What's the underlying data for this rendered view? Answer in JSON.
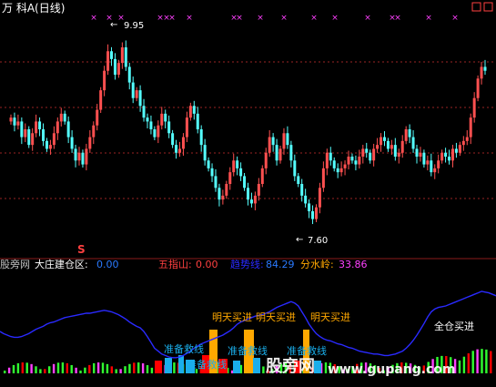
{
  "title": "万 科A(日线)",
  "colors": {
    "up": "#ff5050",
    "down": "#54ffff",
    "grid": "#9a2424",
    "cross": "#ff40ff",
    "orange": "#ffa800",
    "blue": "#2a2aff",
    "cyan": "#1aaeea",
    "red": "#ff0000",
    "green": "#30ff30",
    "magenta": "#ff40ff"
  },
  "chart_data": [
    {
      "type": "candlestick",
      "title": "万 科A(日线)",
      "annotations": {
        "high": "9.95",
        "low": "7.60",
        "marker": "S"
      },
      "ylim": [
        7.4,
        10.2
      ],
      "closes": [
        8.95,
        8.85,
        8.9,
        8.7,
        8.8,
        8.6,
        8.75,
        8.9,
        8.8,
        8.65,
        8.55,
        8.6,
        8.75,
        8.9,
        9.0,
        8.9,
        8.7,
        8.55,
        8.4,
        8.5,
        8.35,
        8.55,
        8.7,
        8.85,
        9.05,
        9.3,
        9.55,
        9.8,
        9.7,
        9.5,
        9.65,
        9.85,
        9.6,
        9.4,
        9.2,
        9.3,
        9.1,
        8.95,
        8.9,
        8.8,
        8.7,
        8.85,
        9.0,
        8.9,
        8.75,
        8.6,
        8.5,
        8.55,
        8.7,
        8.95,
        9.1,
        9.0,
        8.8,
        8.6,
        8.4,
        8.3,
        8.2,
        8.05,
        7.9,
        7.95,
        8.1,
        8.25,
        8.4,
        8.3,
        8.2,
        8.05,
        7.9,
        7.85,
        7.95,
        8.1,
        8.3,
        8.5,
        8.7,
        8.6,
        8.4,
        8.55,
        8.75,
        8.6,
        8.4,
        8.2,
        8.1,
        7.95,
        7.85,
        7.75,
        7.65,
        7.8,
        8.05,
        8.3,
        8.5,
        8.4,
        8.3,
        8.25,
        8.3,
        8.35,
        8.45,
        8.4,
        8.35,
        8.45,
        8.55,
        8.5,
        8.4,
        8.55,
        8.6,
        8.7,
        8.65,
        8.55,
        8.6,
        8.45,
        8.5,
        8.65,
        8.8,
        8.7,
        8.55,
        8.45,
        8.5,
        8.35,
        8.4,
        8.25,
        8.3,
        8.4,
        8.5,
        8.45,
        8.4,
        8.55,
        8.5,
        8.6,
        8.65,
        8.7,
        8.95,
        9.2,
        9.45,
        9.6,
        9.55
      ]
    },
    {
      "type": "indicator",
      "legend": [
        {
          "label": "大庄建仓区:",
          "value": "0.00"
        },
        {
          "label": "五指山:",
          "value": "0.00"
        },
        {
          "label": "趋势线:",
          "value": "84.29"
        },
        {
          "label": "分水岭:",
          "value": "33.86"
        }
      ],
      "signals": [
        "明天买进",
        "明天买进",
        "明天买进"
      ],
      "texts": [
        "全仓买进",
        "准备救线",
        "准备救线",
        "准备救线",
        "准备救线"
      ],
      "left_label": "股旁网",
      "trend_line": [
        45,
        42,
        40,
        38,
        37,
        37,
        38,
        40,
        42,
        45,
        48,
        50,
        52,
        55,
        57,
        58,
        60,
        62,
        64,
        65,
        66,
        67,
        68,
        69,
        70,
        70,
        71,
        72,
        73,
        74,
        73,
        72,
        70,
        68,
        65,
        62,
        58,
        55,
        52,
        50,
        45,
        38,
        30,
        22,
        18,
        14,
        12,
        10,
        9,
        9,
        10,
        12,
        15,
        18,
        22,
        25,
        28,
        30,
        32,
        34,
        36,
        38,
        40,
        43,
        46,
        50,
        55,
        58,
        60,
        62,
        64,
        66,
        67,
        68,
        70,
        72,
        75,
        78,
        80,
        82,
        84,
        86,
        84,
        80,
        72,
        64,
        55,
        48,
        42,
        38,
        35,
        33,
        32,
        30,
        28,
        27,
        25,
        23,
        22,
        20,
        18,
        17,
        16,
        15,
        14,
        14,
        13,
        12,
        12,
        13,
        14,
        16,
        18,
        22,
        27,
        33,
        40,
        48,
        56,
        65,
        72,
        76,
        78,
        79,
        80,
        82,
        84,
        86,
        88,
        90,
        92,
        94,
        96,
        98,
        100,
        99,
        98,
        96,
        94
      ]
    }
  ],
  "watermark": {
    "text": "股旁网",
    "url": "www.gupang.com"
  }
}
